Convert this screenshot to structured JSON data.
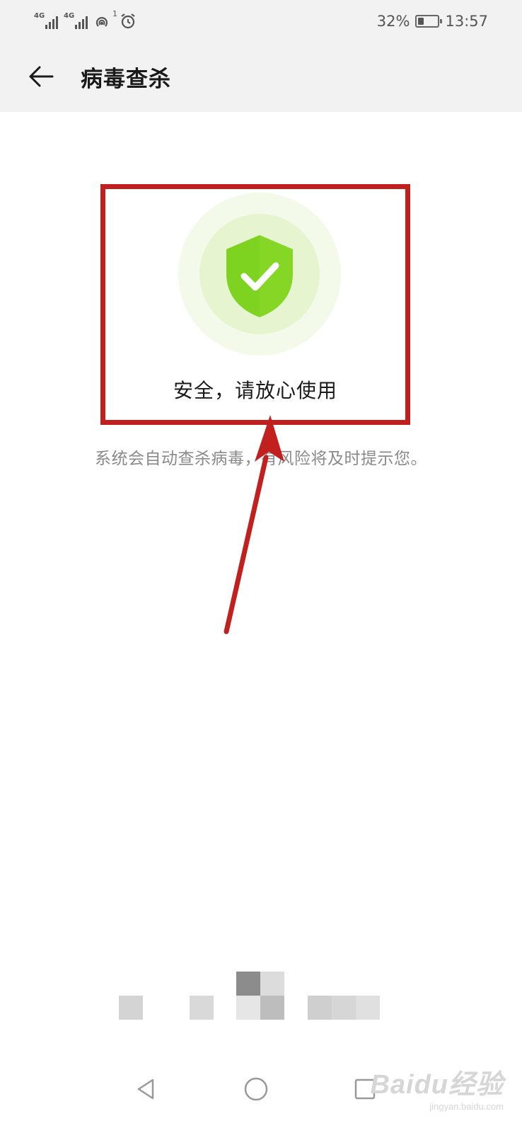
{
  "status_bar": {
    "network_1": "4G",
    "network_2": "4G",
    "notification_count": "1",
    "battery": "32%",
    "battery_level": 0.32,
    "time": "13:57"
  },
  "header": {
    "title": "病毒查杀"
  },
  "status_card": {
    "message": "安全，请放心使用"
  },
  "description": "系统会自动查杀病毒，有风险将及时提示您。",
  "icons": {
    "back": "back-arrow-icon",
    "shield": "shield-check-icon",
    "nav_back": "triangle-back-icon",
    "nav_home": "circle-home-icon",
    "nav_recents": "square-recents-icon"
  },
  "colors": {
    "shield": "#7ed321",
    "annotation": "#c2201f",
    "header_bg": "#f2f2f2"
  },
  "watermark": {
    "brand": "Baidu经验",
    "url": "jingyan.baidu.com"
  }
}
